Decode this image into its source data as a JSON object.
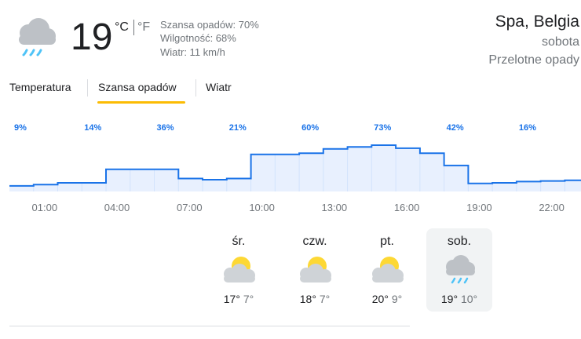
{
  "current": {
    "icon": "rain-cloud-icon",
    "temperature": "19",
    "unit_c": "°C",
    "unit_f": "°F",
    "precip_chance": "Szansa opadów: 70%",
    "humidity": "Wilgotność: 68%",
    "wind": "Wiatr: 11 km/h"
  },
  "location": {
    "name": "Spa, Belgia",
    "day": "sobota",
    "condition": "Przelotne opady"
  },
  "tabs": [
    {
      "label": "Temperatura",
      "selected": false
    },
    {
      "label": "Szansa opadów",
      "selected": true
    },
    {
      "label": "Wiatr",
      "selected": false
    }
  ],
  "colors": {
    "accent_tab": "#fbbc04",
    "chart_line": "#1a73e8",
    "chart_fill": "#e8f0fe",
    "label_blue": "#1a73e8",
    "muted": "#70757a"
  },
  "chart_data": {
    "type": "area",
    "x": [
      "00:00",
      "01:00",
      "02:00",
      "03:00",
      "04:00",
      "05:00",
      "06:00",
      "07:00",
      "08:00",
      "09:00",
      "10:00",
      "11:00",
      "12:00",
      "13:00",
      "14:00",
      "15:00",
      "16:00",
      "17:00",
      "18:00",
      "19:00",
      "20:00",
      "21:00",
      "22:00",
      "23:00"
    ],
    "values": [
      9,
      11,
      14,
      14,
      36,
      36,
      36,
      21,
      19,
      21,
      60,
      60,
      62,
      69,
      72,
      75,
      70,
      62,
      42,
      13,
      14,
      16,
      17,
      18
    ],
    "labels": [
      {
        "index": 0,
        "text": "9%"
      },
      {
        "index": 3,
        "text": "14%"
      },
      {
        "index": 6,
        "text": "36%"
      },
      {
        "index": 9,
        "text": "21%"
      },
      {
        "index": 12,
        "text": "60%"
      },
      {
        "index": 15,
        "text": "73%"
      },
      {
        "index": 18,
        "text": "42%"
      },
      {
        "index": 21,
        "text": "16%"
      }
    ],
    "x_ticks": [
      {
        "index": 1,
        "text": "01:00"
      },
      {
        "index": 4,
        "text": "04:00"
      },
      {
        "index": 7,
        "text": "07:00"
      },
      {
        "index": 10,
        "text": "10:00"
      },
      {
        "index": 13,
        "text": "13:00"
      },
      {
        "index": 16,
        "text": "16:00"
      },
      {
        "index": 19,
        "text": "19:00"
      },
      {
        "index": 22,
        "text": "22:00"
      }
    ],
    "ylim": [
      0,
      100
    ],
    "title": "",
    "xlabel": "",
    "ylabel": ""
  },
  "daily": [
    {
      "name": "śr.",
      "icon": "partly-cloudy-sun-icon",
      "hi": "17°",
      "lo": "7°",
      "selected": false
    },
    {
      "name": "czw.",
      "icon": "partly-cloudy-sun-icon",
      "hi": "18°",
      "lo": "7°",
      "selected": false
    },
    {
      "name": "pt.",
      "icon": "partly-cloudy-sun-icon",
      "hi": "20°",
      "lo": "9°",
      "selected": false
    },
    {
      "name": "sob.",
      "icon": "rain-cloud-icon",
      "hi": "19°",
      "lo": "10°",
      "selected": true
    }
  ]
}
